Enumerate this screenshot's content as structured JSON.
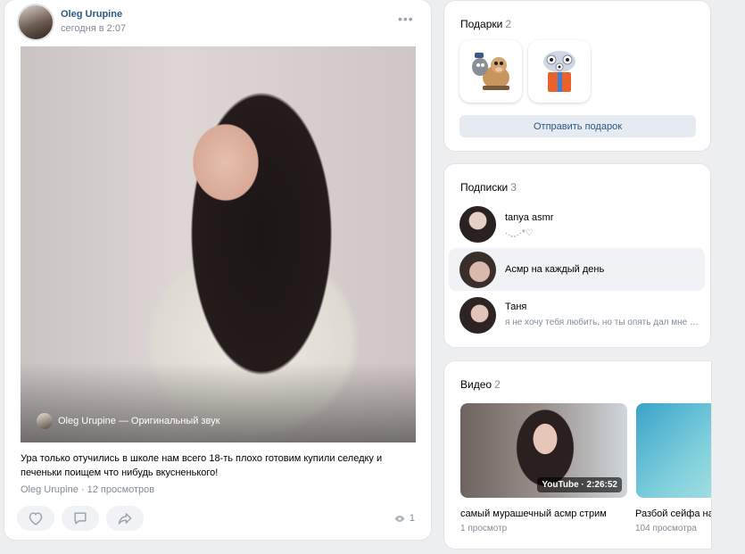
{
  "post": {
    "author": "Oleg Urupine",
    "time": "сегодня в 2:07",
    "sound": "Oleg Urupine — Оригинальный звук",
    "text": "Ура только отучились в школе нам всего 18-ть плохо готовим купили селедку и печеньки поищем что нибудь вкусненького!",
    "meta": "Oleg Urupine · 12 просмотров",
    "views": "1",
    "icons": [
      "more-icon",
      "heart-icon",
      "comment-icon",
      "share-icon",
      "eye-icon"
    ]
  },
  "gifts": {
    "title": "Подарки",
    "count": "2",
    "send_label": "Отправить подарок",
    "items": [
      "cartoon-animals-gift",
      "robots-giftbox-gift"
    ]
  },
  "subscriptions": {
    "title": "Подписки",
    "count": "3",
    "items": [
      {
        "name": "tanya asmr",
        "desc": "·.¸¸.·*♡"
      },
      {
        "name": "Асмр на каждый день",
        "desc": ""
      },
      {
        "name": "Таня",
        "desc": "я не хочу тебя любить, но ты опять дал мне повод"
      }
    ]
  },
  "videos": {
    "title": "Видео",
    "count": "2",
    "items": [
      {
        "badge": "YouTube · 2:26:52",
        "title": "самый мурашечный асмр стрим",
        "views": "1 просмотр"
      },
      {
        "badge": "",
        "title": "Разбой сейфа на",
        "views": "104 просмотра"
      }
    ]
  },
  "colors": {
    "link": "#2a5885",
    "muted": "#818c99",
    "background": "#edeef0",
    "button": "#e5ebf1"
  }
}
